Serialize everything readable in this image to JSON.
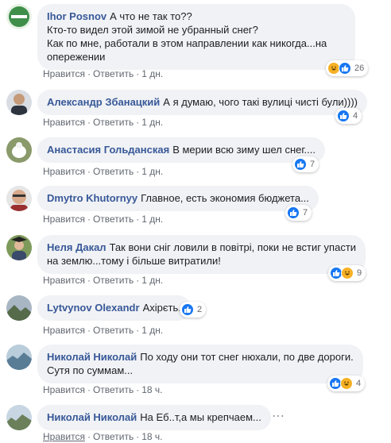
{
  "actions": {
    "like": "Нравится",
    "reply": "Ответить",
    "sep": "·"
  },
  "comments": [
    {
      "author": "Ihor Posnov",
      "text": "А что не так то??\nКто-то видел этой зимой не убранный снег?\nКак по мне, работали в этом направлении как никогда...на опережении",
      "time": "1 дн.",
      "reactions": [
        "haha",
        "like"
      ],
      "count": "26",
      "avatar_color": "#3f8f4b"
    },
    {
      "author": "Александр Збанацкий",
      "text": "А я думаю, чого такі вулиці чисті були))))",
      "time": "1 дн.",
      "reactions": [
        "like"
      ],
      "count": "4",
      "avatar_color": "#3a3f4a"
    },
    {
      "author": "Анастасия Гольданская",
      "text": "В мерии всю зиму шел снег....",
      "time": "1 дн.",
      "reactions": [
        "like"
      ],
      "count": "7",
      "avatar_color": "#4f5a3a"
    },
    {
      "author": "Dmytro Khutornyy",
      "text": "Главное, есть экономия бюджета...",
      "time": "1 дн.",
      "reactions": [
        "like"
      ],
      "count": "7",
      "avatar_color": "#c9a389"
    },
    {
      "author": "Неля Дакал",
      "text": "Так вони сніг ловили в повітрі, поки не встиг упасти\nна землю...тому і більше витратили!",
      "time": "1 дн.",
      "reactions": [
        "like",
        "haha"
      ],
      "count": "9",
      "avatar_color": "#6d8a4b"
    },
    {
      "author": "Lytvynov Olexandr",
      "text": "Ахірєть.",
      "time": "1 дн.",
      "reactions": [
        "like"
      ],
      "count": "2",
      "avatar_color": "#556b4a"
    },
    {
      "author": "Николай Николай",
      "text": "По ходу они тот снег нюхали, по две дороги.\nСутя по суммам...",
      "time": "18 ч.",
      "reactions": [
        "like",
        "haha"
      ],
      "count": "4",
      "avatar_color": "#5a7d96"
    },
    {
      "author": "Николай Николай",
      "text": "На Еб..т,а мы крепчаем...",
      "time": "18 ч.",
      "reactions": [],
      "count": "",
      "avatar_color": "#6a7f5a"
    }
  ]
}
